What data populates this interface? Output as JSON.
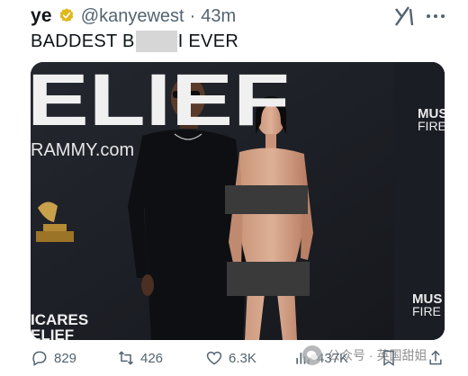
{
  "tweet": {
    "author_name": "ye",
    "handle": "@kanyewest",
    "separator": "·",
    "time": "43m",
    "text_before": "BADDEST B",
    "text_after": "I EVER"
  },
  "media": {
    "backdrop_text_top": "ELIEF",
    "backdrop_text_site": "RAMMY.com",
    "backdrop_text_bottom_1": "ICARES",
    "backdrop_text_bottom_2": "ELIEF",
    "side_text_top_1": "MUS",
    "side_text_top_2": "FIRE",
    "side_text_bottom_1": "MUS",
    "side_text_bottom_2": "FIRE"
  },
  "actions": {
    "replies": "829",
    "retweets": "426",
    "likes": "6.3K",
    "views": "437K"
  },
  "watermark": {
    "text": "公众号 · 英国甜姐"
  },
  "colors": {
    "text_primary": "#0f1419",
    "text_secondary": "#536471",
    "verified_gold": "#e2b719",
    "media_bg": "#1c1f27"
  },
  "icons": [
    "verified-icon",
    "grok-icon",
    "more-icon",
    "reply-icon",
    "retweet-icon",
    "like-icon",
    "views-icon",
    "bookmark-icon",
    "share-icon"
  ]
}
